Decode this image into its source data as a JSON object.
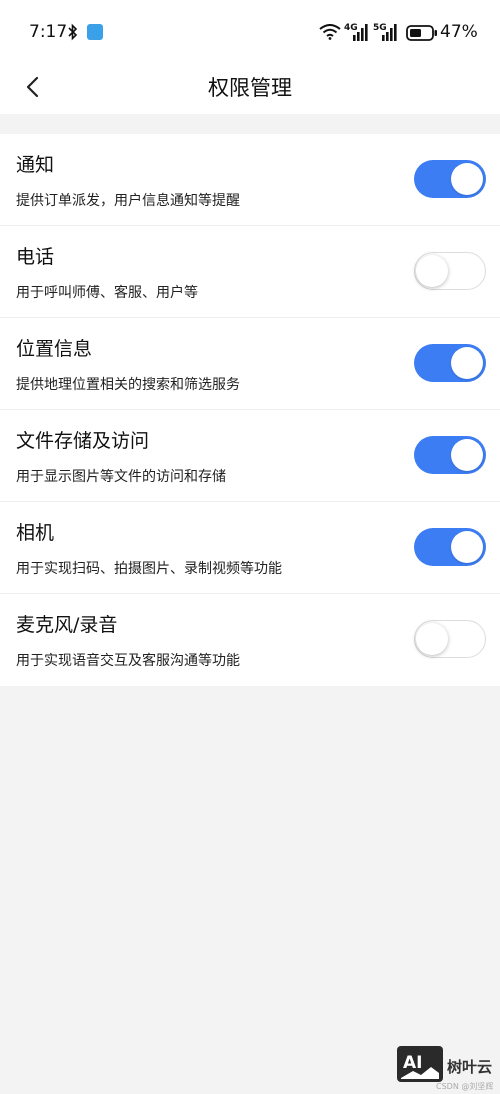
{
  "status_bar": {
    "time": "7:17",
    "net1": "4G",
    "net2": "5G",
    "battery": "47%",
    "icons": [
      "bluetooth-icon",
      "app-notification-icon",
      "wifi-icon",
      "signal-icon",
      "signal-icon",
      "battery-icon"
    ]
  },
  "nav": {
    "title": "权限管理",
    "back_icon": "chevron-left-icon"
  },
  "permissions": [
    {
      "title": "通知",
      "desc": "提供订单派发，用户信息通知等提醒",
      "enabled": true
    },
    {
      "title": "电话",
      "desc": "用于呼叫师傅、客服、用户等",
      "enabled": false
    },
    {
      "title": "位置信息",
      "desc": "提供地理位置相关的搜索和筛选服务",
      "enabled": true
    },
    {
      "title": "文件存储及访问",
      "desc": "用于显示图片等文件的访问和存储",
      "enabled": true
    },
    {
      "title": "相机",
      "desc": "用于实现扫码、拍摄图片、录制视频等功能",
      "enabled": true
    },
    {
      "title": "麦克风/录音",
      "desc": "用于实现语音交互及客服沟通等功能",
      "enabled": false
    }
  ],
  "watermark": {
    "logo_text": "AI",
    "brand": "树叶云",
    "credit": "CSDN @刘坚辉"
  },
  "colors": {
    "toggle_on": "#3c7df3",
    "toggle_off_border": "#dcdcdc",
    "page_bg": "#f3f3f3"
  }
}
